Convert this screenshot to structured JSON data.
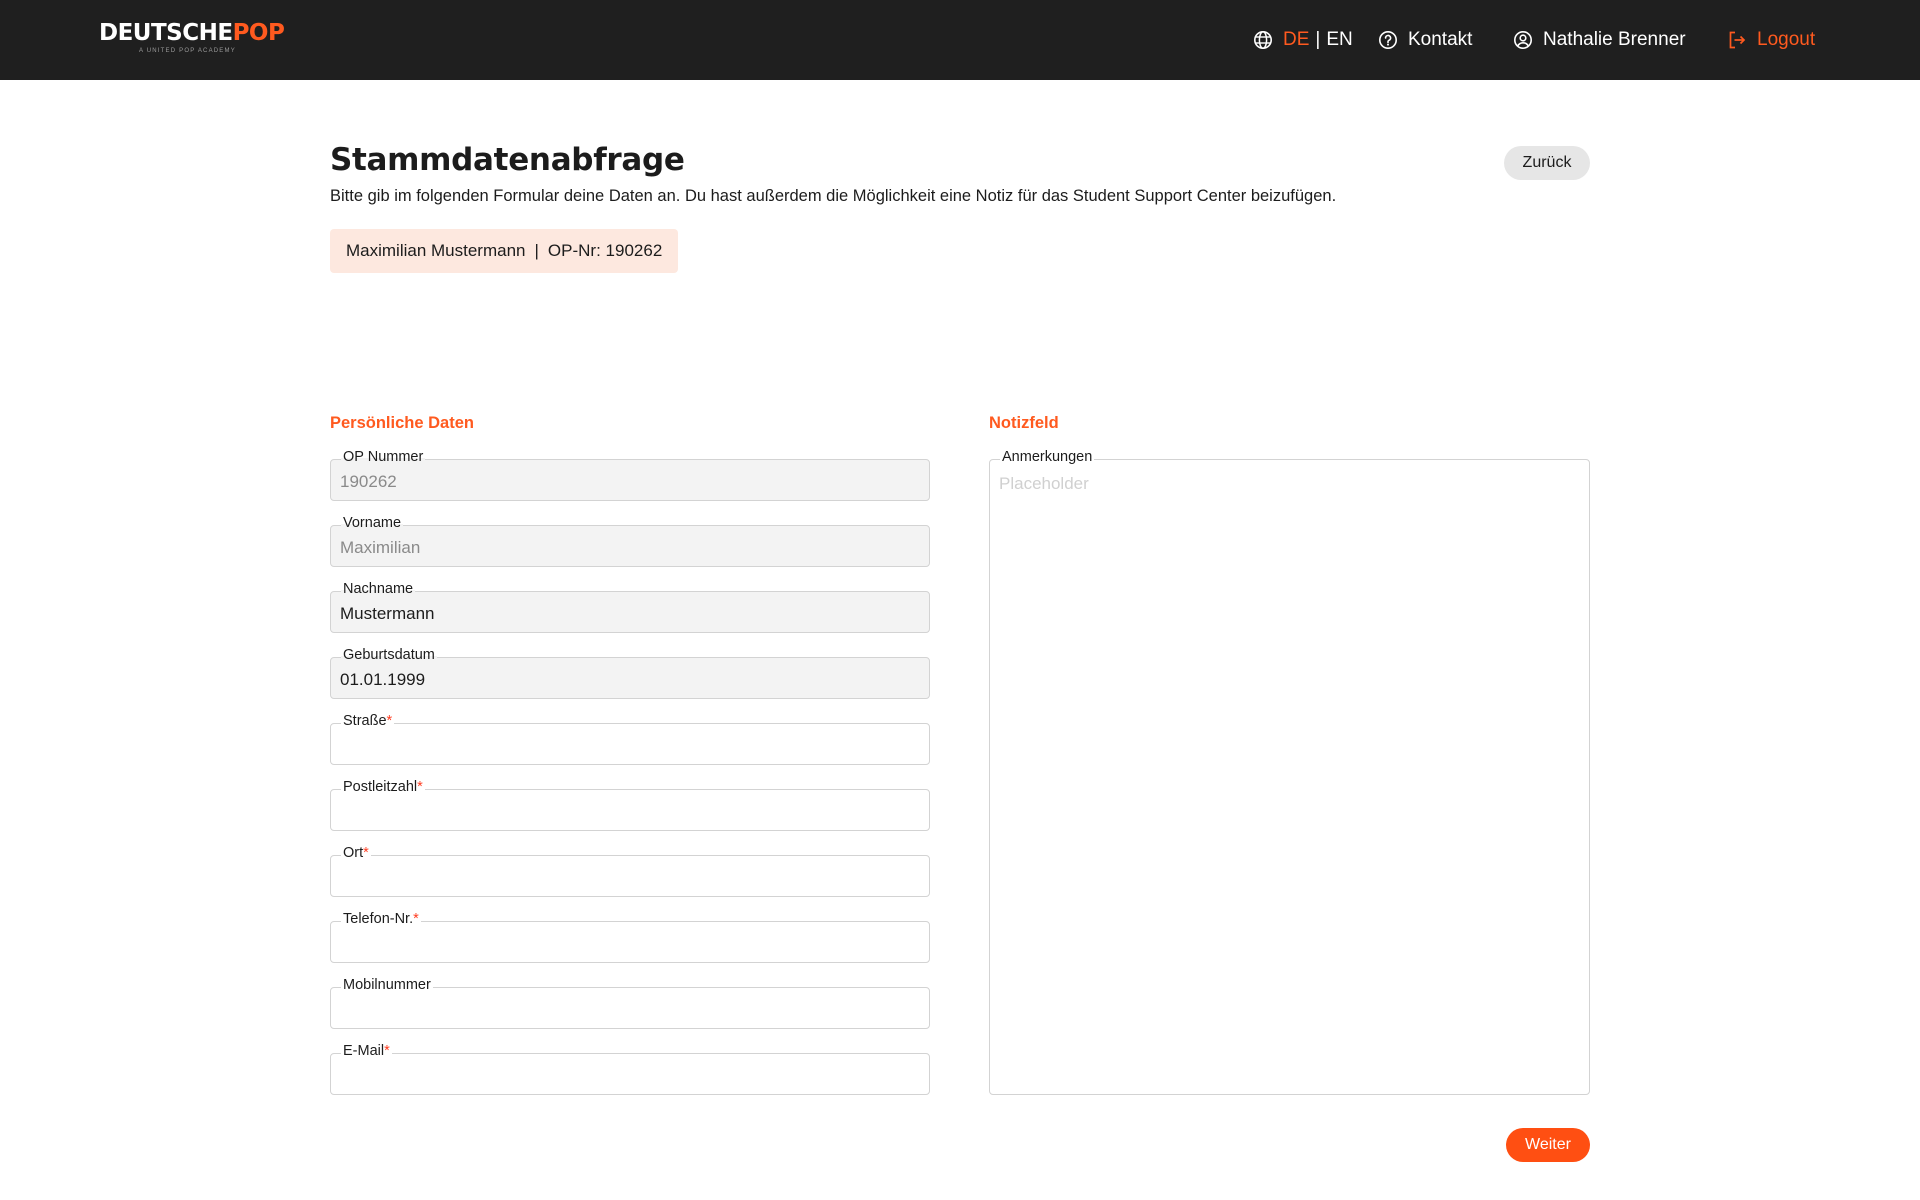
{
  "header": {
    "logo_main": "DEUTSCHE",
    "logo_accent": "POP",
    "logo_sub": "A UNITED POP ACADEMY",
    "lang_de": "DE",
    "lang_sep": "|",
    "lang_en": "EN",
    "contact_label": "Kontakt",
    "user_name": "Nathalie Brenner",
    "logout_label": "Logout"
  },
  "page": {
    "title": "Stammdatenabfrage",
    "description": "Bitte gib im folgenden Formular deine Daten an. Du hast außerdem die Möglichkeit eine Notiz  für das Student Support Center beizufügen.",
    "back_label": "Zurück",
    "person_name": "Maximilian Mustermann",
    "person_sep": "|",
    "op_label": "OP-Nr:",
    "op_number": "190262"
  },
  "personal": {
    "section_title": "Persönliche Daten",
    "fields": [
      {
        "label": "OP Nummer",
        "required": false,
        "value": "190262"
      },
      {
        "label": "Vorname",
        "required": false,
        "value": "Maximilian"
      },
      {
        "label": "Nachname",
        "required": false,
        "value": "Mustermann"
      },
      {
        "label": "Geburtsdatum",
        "required": false,
        "value": "01.01.1999"
      },
      {
        "label": "Straße",
        "required": true,
        "value": ""
      },
      {
        "label": "Postleitzahl",
        "required": true,
        "value": ""
      },
      {
        "label": "Ort",
        "required": true,
        "value": ""
      },
      {
        "label": "Telefon-Nr.",
        "required": true,
        "value": ""
      },
      {
        "label": "Mobilnummer",
        "required": false,
        "value": ""
      },
      {
        "label": "E-Mail",
        "required": true,
        "value": ""
      }
    ],
    "required_marker": "*"
  },
  "notes": {
    "section_title": "Notizfeld",
    "label": "Anmerkungen",
    "placeholder": "Placeholder"
  },
  "actions": {
    "next_label": "Weiter"
  },
  "colors": {
    "accent": "#ff5a1f",
    "header_bg": "#1f1f1f",
    "chip_bg": "#fde8df",
    "required": "#ff3b1f"
  }
}
